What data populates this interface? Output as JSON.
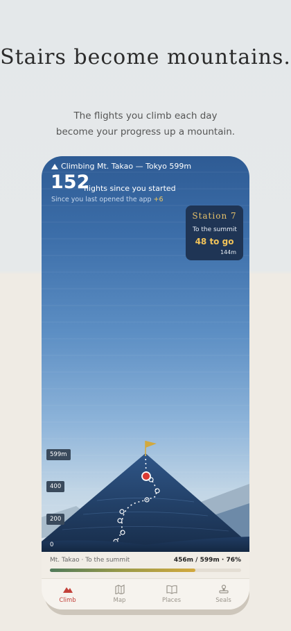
{
  "hero": {
    "headline": "Stairs become mountains.",
    "subline_1": "The flights you climb each day",
    "subline_2": "become your progress up a mountain."
  },
  "app": {
    "location": "Climbing Mt. Takao — Tokyo 599m",
    "total_flights": "152",
    "total_label": "flights since you started",
    "since_label": "Since you last opened the app",
    "since_delta": "+6",
    "station": {
      "title": "Station 7",
      "subtitle": "To the summit",
      "to_go": "48 to go",
      "meters": "144m"
    },
    "altitude_labels": [
      "599m",
      "400",
      "200",
      "0"
    ],
    "progress": {
      "label": "Mt. Takao · To the summit",
      "value": "456m / 599m · 76%",
      "fraction": 0.76
    },
    "tabs": [
      {
        "label": "Climb",
        "icon": "mountain-icon",
        "active": true
      },
      {
        "label": "Map",
        "icon": "map-icon",
        "active": false
      },
      {
        "label": "Places",
        "icon": "book-icon",
        "active": false
      },
      {
        "label": "Seals",
        "icon": "stamp-icon",
        "active": false
      }
    ],
    "colors": {
      "accent": "#c2413a",
      "station_gold": "#f2c45a",
      "sky_top": "#2e5b94",
      "mountain": "#1f3555"
    }
  }
}
